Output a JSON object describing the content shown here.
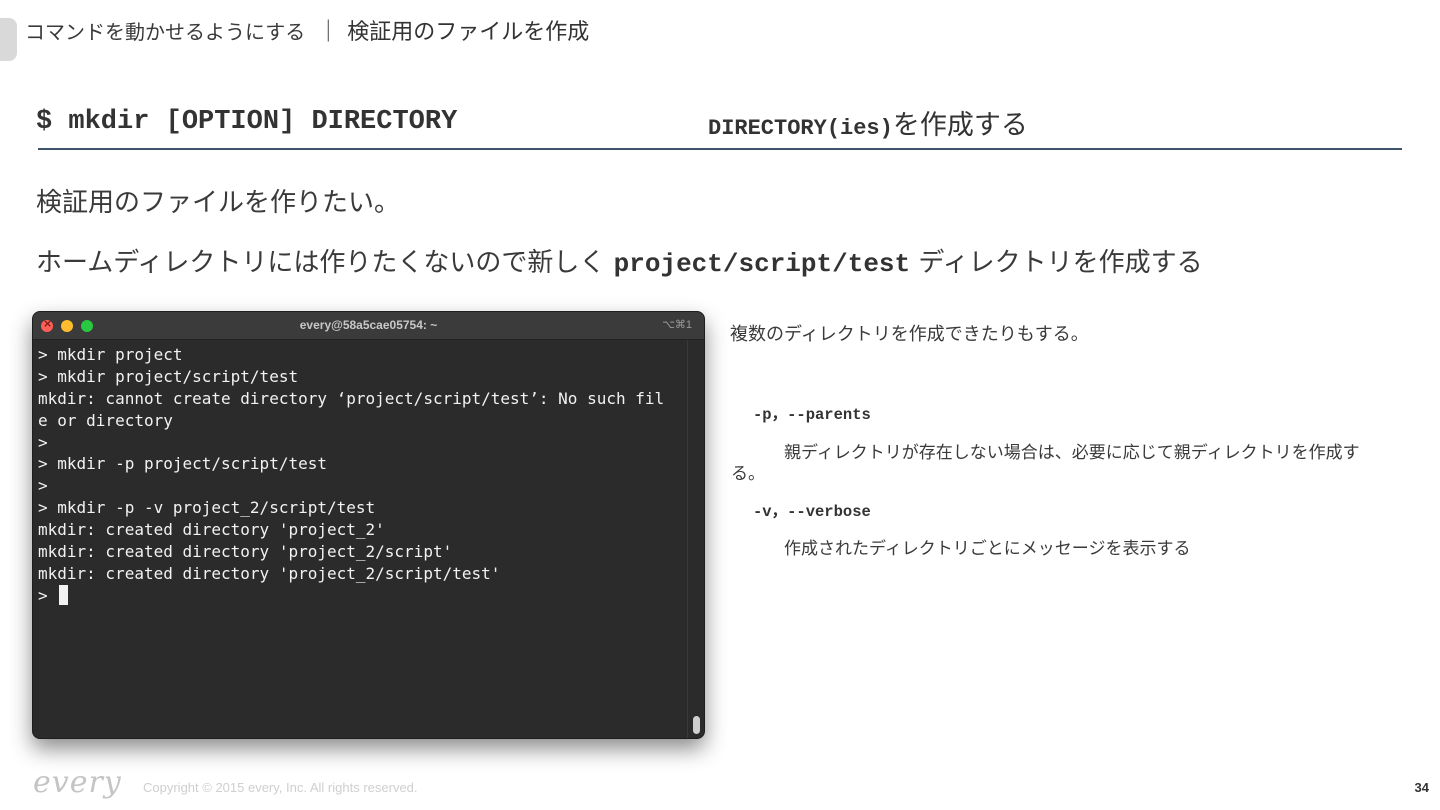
{
  "header": {
    "subtitle": "コマンドを動かせるようにする",
    "separator": "｜",
    "title": "検証用のファイルを作成"
  },
  "command": {
    "syntax": "$ mkdir [OPTION] DIRECTORY",
    "desc_code": "DIRECTORY(ies)",
    "desc_text": "を作成する"
  },
  "body": {
    "line1": "検証用のファイルを作りたい。",
    "line2_pre": "ホームディレクトリには作りたくないので新しく ",
    "line2_code": "project/script/test",
    "line2_post": " ディレクトリを作成する"
  },
  "terminal": {
    "title": "every@58a5cae05754: ~",
    "shortcut": "⌥⌘1",
    "lines": [
      "> mkdir project",
      "> mkdir project/script/test",
      "mkdir: cannot create directory ‘project/script/test’: No such fil",
      "e or directory",
      ">",
      "> mkdir -p project/script/test",
      ">",
      "> mkdir -p -v project_2/script/test",
      "mkdir: created directory 'project_2'",
      "mkdir: created directory 'project_2/script'",
      "mkdir: created directory 'project_2/script/test'"
    ],
    "prompt": "> "
  },
  "notes": {
    "intro": "複数のディレクトリを作成できたりもする。",
    "opt_p": "-p，--parents",
    "opt_p_desc_1": "親ディレクトリが存在しない場合は、必要に応じて親ディレクトリを作成す",
    "opt_p_desc_2": "る。",
    "opt_v": "-v，--verbose",
    "opt_v_desc": "作成されたディレクトリごとにメッセージを表示する"
  },
  "footer": {
    "logo": "every",
    "copyright": "Copyright © 2015 every, Inc. All rights reserved.",
    "page": "34"
  }
}
